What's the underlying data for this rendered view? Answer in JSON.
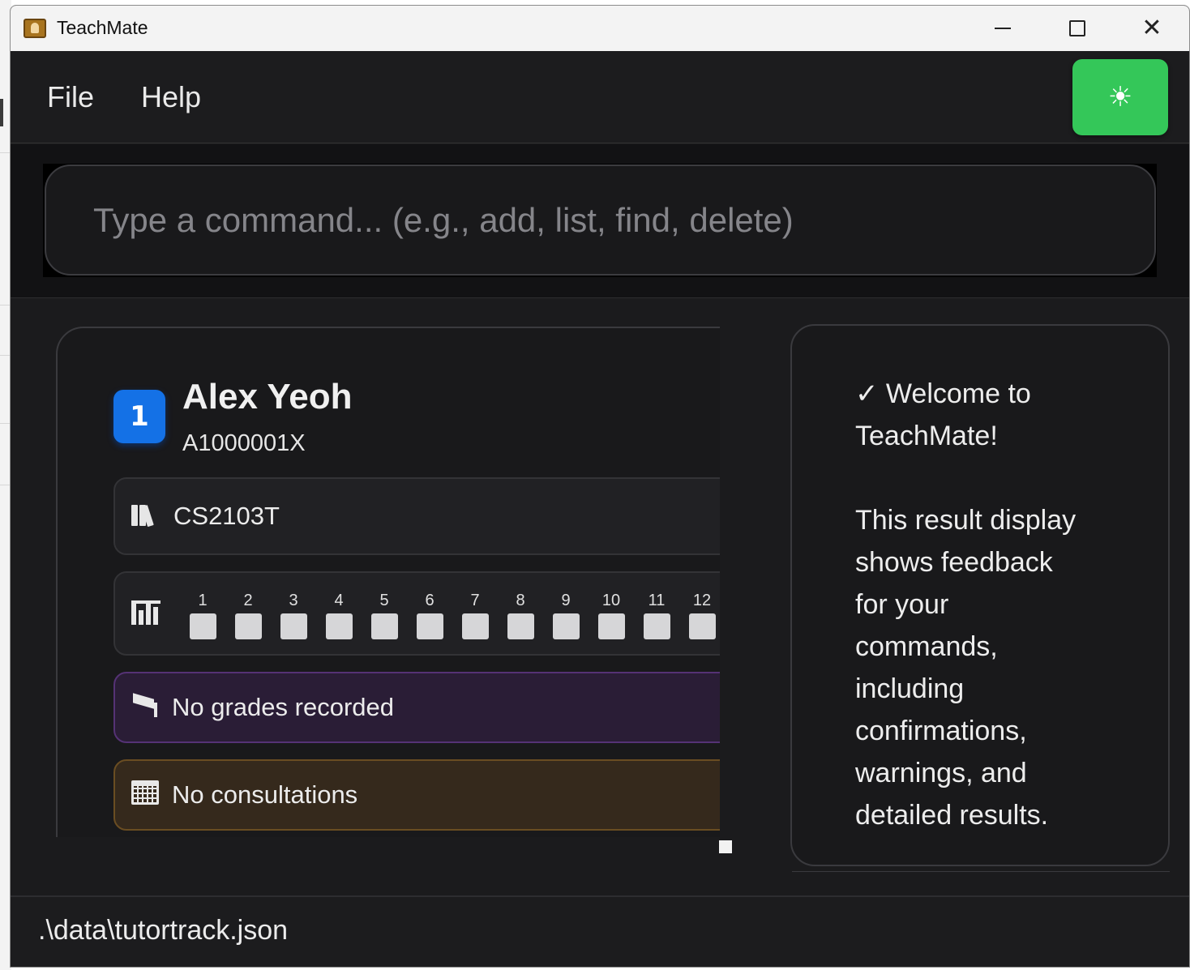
{
  "window": {
    "title": "TeachMate"
  },
  "menu": {
    "file": "File",
    "help": "Help"
  },
  "theme_toggle": {
    "icon": "sun-icon",
    "glyph": "☀",
    "color": "#34c759"
  },
  "command": {
    "placeholder": "Type a command... (e.g., add, list, find, delete)",
    "value": ""
  },
  "student": {
    "index": "1",
    "name": "Alex Yeoh",
    "id": "A1000001X",
    "course": "CS2103T",
    "weeks": [
      "1",
      "2",
      "3",
      "4",
      "5",
      "6",
      "7",
      "8",
      "9",
      "10",
      "11",
      "12"
    ],
    "grades": "No grades recorded",
    "consultations": "No consultations"
  },
  "result": {
    "text": "✓ Welcome to\nTeachMate!\n\nThis result display\nshows feedback\nfor your\ncommands,\nincluding\nconfirmations,\nwarnings, and\ndetailed results."
  },
  "status": {
    "path": ".\\data\\tutortrack.json"
  },
  "colors": {
    "badge": "#1471e6",
    "grades_bg": "#2a1d36",
    "consult_bg": "#35291c",
    "accent_green": "#34c759"
  }
}
